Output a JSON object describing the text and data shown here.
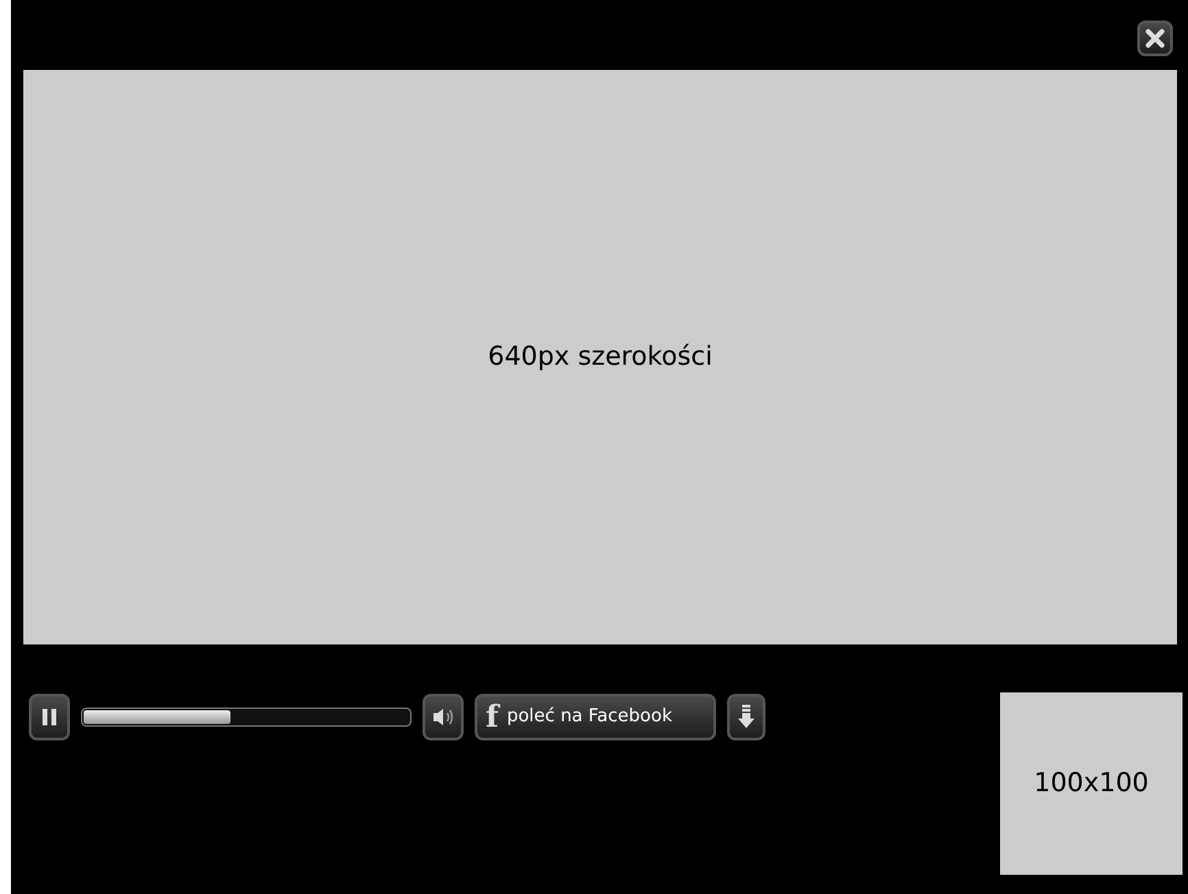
{
  "video": {
    "label": "640px szerokości"
  },
  "controls": {
    "playing": true,
    "progress": {
      "level": 0.45
    },
    "facebook": {
      "logo": "f",
      "label": "poleć na Facebook"
    }
  },
  "thumbnail": {
    "label": "100x100"
  }
}
